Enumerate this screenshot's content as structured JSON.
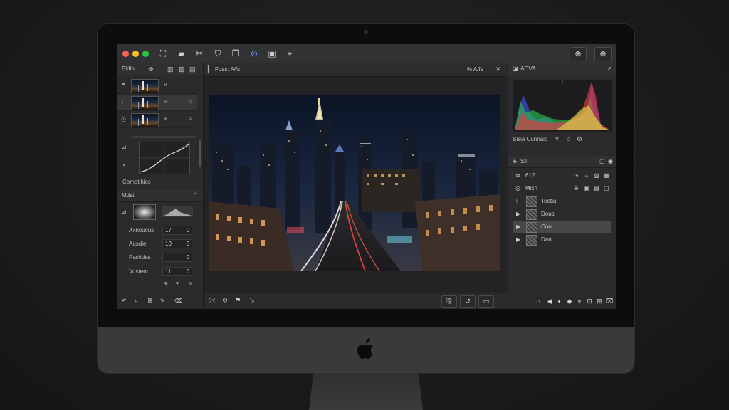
{
  "toolbar": {
    "items": [
      "crop-icon",
      "folder-icon",
      "adjust-icon",
      "stamp-icon",
      "layers-icon",
      "brush-icon",
      "export-icon",
      "select-icon"
    ]
  },
  "left_panel": {
    "header_label": "Bidio",
    "curves_label": "Comatihics",
    "section_label": "Mdst",
    "sliders": [
      {
        "label": "Axnoucus",
        "value_a": "17",
        "value_b": "0"
      },
      {
        "label": "Ausdie",
        "value_a": "10",
        "value_b": "0"
      },
      {
        "label": "Pastides",
        "value_a": "",
        "value_b": "0"
      },
      {
        "label": "Vustem",
        "value_a": "11",
        "value_b": "0"
      }
    ]
  },
  "center": {
    "title": "Foss: A/fs",
    "zoom_label": "% A/fs",
    "image_name": "night-city-street"
  },
  "right_panel": {
    "histogram_title": "AOVA",
    "histogram_label": "Bisia Cunnaio",
    "layers_title": "Sil",
    "opacity_value": "612",
    "blend_label": "Mixn",
    "layers": [
      {
        "name": "Teotia",
        "selected": false
      },
      {
        "name": "Dous",
        "selected": false
      },
      {
        "name": "Con",
        "selected": true
      },
      {
        "name": "Dan",
        "selected": false
      }
    ]
  },
  "colors": {
    "accent": "#3a7bd5",
    "panel": "#2b2b2d",
    "window": "#262628"
  }
}
